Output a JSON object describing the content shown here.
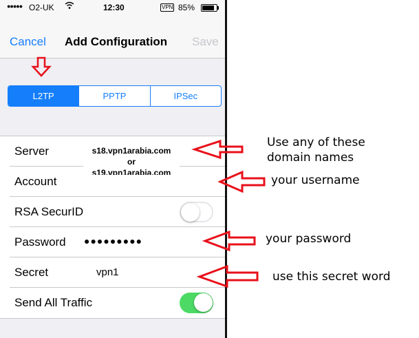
{
  "status_bar": {
    "signal": "●●●●●",
    "carrier": "O2-UK",
    "time": "12:30",
    "vpn": "VPN",
    "battery": "85%"
  },
  "nav": {
    "cancel": "Cancel",
    "title": "Add Configuration",
    "save": "Save"
  },
  "segments": [
    "L2TP",
    "PPTP",
    "IPSec"
  ],
  "form": {
    "server_label": "Server",
    "server_line1": "s18.vpn1arabia.com",
    "server_or": "or",
    "server_line2": "s19.vpn1arabia.com",
    "account_label": "Account",
    "rsa_label": "RSA SecurID",
    "password_label": "Password",
    "password_value": "●●●●●●●●●",
    "secret_label": "Secret",
    "secret_value": "vpn1",
    "send_all_label": "Send All Traffic"
  },
  "annotations": {
    "server_line1": "Use any of these",
    "server_line2": "domain names",
    "username": "your username",
    "password": "your password",
    "secret": "use this secret word"
  },
  "colors": {
    "ios_blue": "#157efb",
    "toggle_green": "#4cd964",
    "arrow_red": "#e8101a"
  }
}
